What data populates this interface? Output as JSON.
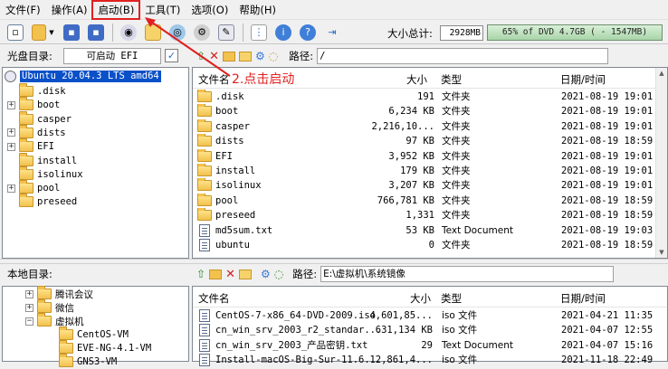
{
  "menu": [
    {
      "label": "文件(F)"
    },
    {
      "label": "操作(A)"
    },
    {
      "label": "启动(B)"
    },
    {
      "label": "工具(T)"
    },
    {
      "label": "选项(O)"
    },
    {
      "label": "帮助(H)"
    }
  ],
  "toolbar": {
    "icons": [
      "new-icon",
      "open-icon",
      "dropdown-icon",
      "save-icon",
      "saveas-icon",
      "burn-icon",
      "mount-icon",
      "compress-icon",
      "convert-icon",
      "properties-icon",
      "info-icon",
      "help-icon",
      "exit-icon"
    ],
    "size_label": "大小总计:",
    "size_value": "2928MB",
    "size_bar_text": "65% of DVD 4.7GB ( - 1547MB)",
    "size_bar_percent": 65,
    "accent_color": "#a8d4a8"
  },
  "cd_pane": {
    "title": "光盘目录:",
    "boot_label": "可启动 EFI",
    "path_label": "路径:",
    "path_value": "/",
    "tree_root": "Ubuntu 20.04.3 LTS amd64",
    "tree": [
      {
        "label": ".disk",
        "expandable": false
      },
      {
        "label": "boot",
        "expandable": true
      },
      {
        "label": "casper",
        "expandable": false
      },
      {
        "label": "dists",
        "expandable": true
      },
      {
        "label": "EFI",
        "expandable": true
      },
      {
        "label": "install",
        "expandable": false
      },
      {
        "label": "isolinux",
        "expandable": false
      },
      {
        "label": "pool",
        "expandable": true
      },
      {
        "label": "preseed",
        "expandable": false
      }
    ],
    "columns": {
      "name": "文件名",
      "size": "大小",
      "type": "类型",
      "date": "日期/时间"
    },
    "files": [
      {
        "name": ".disk",
        "size": "191",
        "type": "文件夹",
        "date": "2021-08-19 19:01",
        "kind": "folder"
      },
      {
        "name": "boot",
        "size": "6,234 KB",
        "type": "文件夹",
        "date": "2021-08-19 19:01",
        "kind": "folder"
      },
      {
        "name": "casper",
        "size": "2,216,10...",
        "type": "文件夹",
        "date": "2021-08-19 19:01",
        "kind": "folder"
      },
      {
        "name": "dists",
        "size": "97 KB",
        "type": "文件夹",
        "date": "2021-08-19 18:59",
        "kind": "folder"
      },
      {
        "name": "EFI",
        "size": "3,952 KB",
        "type": "文件夹",
        "date": "2021-08-19 19:01",
        "kind": "folder"
      },
      {
        "name": "install",
        "size": "179 KB",
        "type": "文件夹",
        "date": "2021-08-19 19:01",
        "kind": "folder"
      },
      {
        "name": "isolinux",
        "size": "3,207 KB",
        "type": "文件夹",
        "date": "2021-08-19 19:01",
        "kind": "folder"
      },
      {
        "name": "pool",
        "size": "766,781 KB",
        "type": "文件夹",
        "date": "2021-08-19 18:59",
        "kind": "folder"
      },
      {
        "name": "preseed",
        "size": "1,331",
        "type": "文件夹",
        "date": "2021-08-19 18:59",
        "kind": "folder"
      },
      {
        "name": "md5sum.txt",
        "size": "53 KB",
        "type": "Text Document",
        "date": "2021-08-19 19:03",
        "kind": "file"
      },
      {
        "name": "ubuntu",
        "size": "0",
        "type": "文件夹",
        "date": "2021-08-19 18:59",
        "kind": "file"
      }
    ]
  },
  "annotation": "2.点击启动",
  "local_pane": {
    "title": "本地目录:",
    "path_label": "路径:",
    "path_value": "E:\\虚拟机\\系统镜像",
    "tree": [
      {
        "label": "腾讯会议",
        "expandable": true
      },
      {
        "label": "微信",
        "expandable": true
      },
      {
        "label": "虚拟机",
        "expandable": true,
        "expanded": true
      },
      {
        "label": "CentOS-VM",
        "expandable": false
      },
      {
        "label": "EVE-NG-4.1-VM",
        "expandable": false
      },
      {
        "label": "GNS3-VM",
        "expandable": false
      }
    ],
    "columns": {
      "name": "文件名",
      "size": "大小",
      "type": "类型",
      "date": "日期/时间"
    },
    "files": [
      {
        "name": "CentOS-7-x86_64-DVD-2009.iso",
        "size": "4,601,85...",
        "type": "iso 文件",
        "date": "2021-04-21 11:35"
      },
      {
        "name": "cn_win_srv_2003_r2_standar...",
        "size": "631,134 KB",
        "type": "iso 文件",
        "date": "2021-04-07 12:55"
      },
      {
        "name": "cn_win_srv_2003_产品密钥.txt",
        "size": "29",
        "type": "Text Document",
        "date": "2021-04-07 15:16"
      },
      {
        "name": "Install-macOS-Big-Sur-11.6...",
        "size": "12,861,4...",
        "type": "iso 文件",
        "date": "2021-11-18 22:49"
      }
    ]
  }
}
